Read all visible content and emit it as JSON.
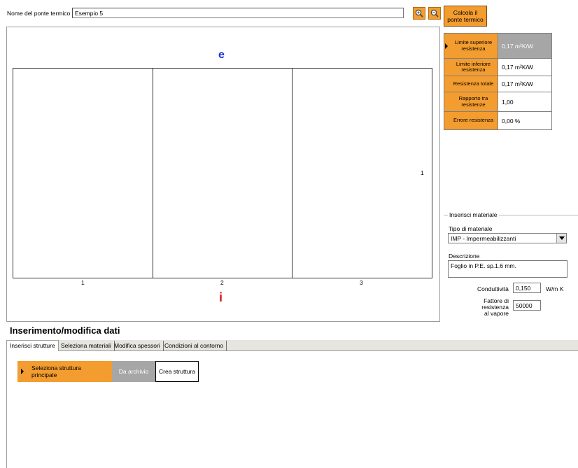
{
  "header": {
    "name_label": "Nome del ponte termico",
    "name_value": "Esempio 5",
    "zoom_in_icon": "zoom-in-icon",
    "zoom_out_icon": "zoom-out-icon",
    "calc_label_line1": "Calcola il",
    "calc_label_line2": "ponte termico"
  },
  "canvas": {
    "outer_label": "e",
    "inner_label": "i",
    "column_numbers": [
      "1",
      "2",
      "3"
    ],
    "row_numbers": [
      "1"
    ]
  },
  "results": [
    {
      "label": "Limite superiore resistenza",
      "value": "0,17 m²K/W",
      "selected": true
    },
    {
      "label": "Limite inferiore resistenza",
      "value": "0,17 m²K/W",
      "selected": false
    },
    {
      "label": "Resistenza totale",
      "value": "0,17 m²K/W",
      "selected": false
    },
    {
      "label": "Rapporto tra resistenze",
      "value": "1,00",
      "selected": false
    },
    {
      "label": "Errore resistenza",
      "value": "0,00 %",
      "selected": false
    }
  ],
  "material": {
    "group_title": "Inserisci materiale",
    "type_label": "Tipo di materiale",
    "type_value": "IMP - Impermeabilizzanti",
    "desc_label": "Descrizione",
    "desc_value": "Foglio in P.E. sp.1.6 mm.",
    "cond_label": "Conduttività",
    "cond_value": "0,150",
    "cond_unit": "W/m K",
    "vapor_label_line1": "Fattore di resistenza",
    "vapor_label_line2": "al vapore",
    "vapor_value": "50000"
  },
  "data_section": {
    "title": "Inserimento/modifica dati",
    "tabs": [
      "Inserisci strutture",
      "Seleziona materiali",
      "Modifica spessori",
      "Condizioni al contorno"
    ],
    "active_tab": 0,
    "main_button_line1": "Seleziona struttura",
    "main_button_line2": "principale",
    "archive_button": "Da archivio",
    "create_button": "Crea struttura"
  },
  "colors": {
    "accent": "#f39c2f",
    "selected_gray": "#a6a6a6",
    "outer_blue": "#1a2fd8",
    "inner_red": "#d81a1a"
  }
}
